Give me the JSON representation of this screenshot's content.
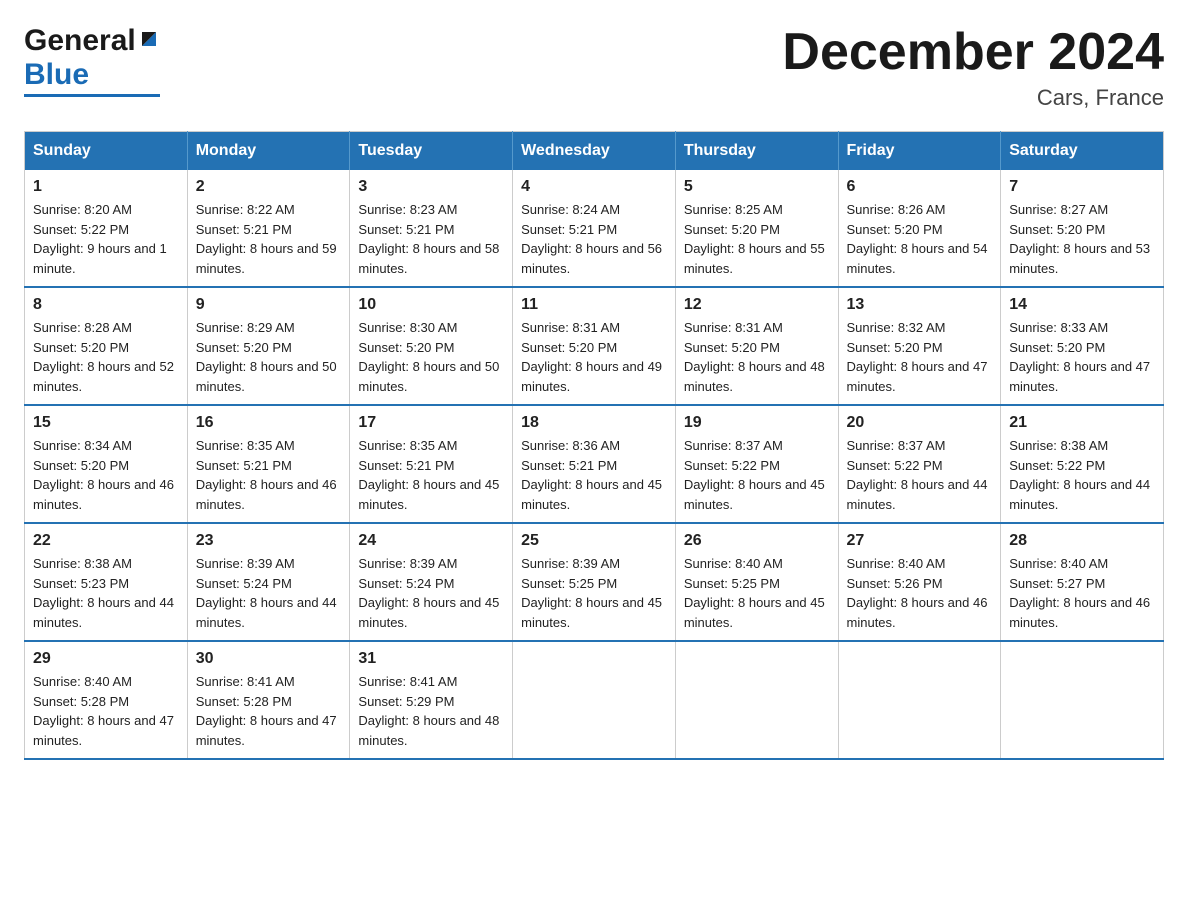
{
  "logo": {
    "general": "General",
    "blue": "Blue"
  },
  "title": "December 2024",
  "location": "Cars, France",
  "days_header": [
    "Sunday",
    "Monday",
    "Tuesday",
    "Wednesday",
    "Thursday",
    "Friday",
    "Saturday"
  ],
  "weeks": [
    [
      {
        "day": "1",
        "sunrise": "8:20 AM",
        "sunset": "5:22 PM",
        "daylight": "9 hours and 1 minute."
      },
      {
        "day": "2",
        "sunrise": "8:22 AM",
        "sunset": "5:21 PM",
        "daylight": "8 hours and 59 minutes."
      },
      {
        "day": "3",
        "sunrise": "8:23 AM",
        "sunset": "5:21 PM",
        "daylight": "8 hours and 58 minutes."
      },
      {
        "day": "4",
        "sunrise": "8:24 AM",
        "sunset": "5:21 PM",
        "daylight": "8 hours and 56 minutes."
      },
      {
        "day": "5",
        "sunrise": "8:25 AM",
        "sunset": "5:20 PM",
        "daylight": "8 hours and 55 minutes."
      },
      {
        "day": "6",
        "sunrise": "8:26 AM",
        "sunset": "5:20 PM",
        "daylight": "8 hours and 54 minutes."
      },
      {
        "day": "7",
        "sunrise": "8:27 AM",
        "sunset": "5:20 PM",
        "daylight": "8 hours and 53 minutes."
      }
    ],
    [
      {
        "day": "8",
        "sunrise": "8:28 AM",
        "sunset": "5:20 PM",
        "daylight": "8 hours and 52 minutes."
      },
      {
        "day": "9",
        "sunrise": "8:29 AM",
        "sunset": "5:20 PM",
        "daylight": "8 hours and 50 minutes."
      },
      {
        "day": "10",
        "sunrise": "8:30 AM",
        "sunset": "5:20 PM",
        "daylight": "8 hours and 50 minutes."
      },
      {
        "day": "11",
        "sunrise": "8:31 AM",
        "sunset": "5:20 PM",
        "daylight": "8 hours and 49 minutes."
      },
      {
        "day": "12",
        "sunrise": "8:31 AM",
        "sunset": "5:20 PM",
        "daylight": "8 hours and 48 minutes."
      },
      {
        "day": "13",
        "sunrise": "8:32 AM",
        "sunset": "5:20 PM",
        "daylight": "8 hours and 47 minutes."
      },
      {
        "day": "14",
        "sunrise": "8:33 AM",
        "sunset": "5:20 PM",
        "daylight": "8 hours and 47 minutes."
      }
    ],
    [
      {
        "day": "15",
        "sunrise": "8:34 AM",
        "sunset": "5:20 PM",
        "daylight": "8 hours and 46 minutes."
      },
      {
        "day": "16",
        "sunrise": "8:35 AM",
        "sunset": "5:21 PM",
        "daylight": "8 hours and 46 minutes."
      },
      {
        "day": "17",
        "sunrise": "8:35 AM",
        "sunset": "5:21 PM",
        "daylight": "8 hours and 45 minutes."
      },
      {
        "day": "18",
        "sunrise": "8:36 AM",
        "sunset": "5:21 PM",
        "daylight": "8 hours and 45 minutes."
      },
      {
        "day": "19",
        "sunrise": "8:37 AM",
        "sunset": "5:22 PM",
        "daylight": "8 hours and 45 minutes."
      },
      {
        "day": "20",
        "sunrise": "8:37 AM",
        "sunset": "5:22 PM",
        "daylight": "8 hours and 44 minutes."
      },
      {
        "day": "21",
        "sunrise": "8:38 AM",
        "sunset": "5:22 PM",
        "daylight": "8 hours and 44 minutes."
      }
    ],
    [
      {
        "day": "22",
        "sunrise": "8:38 AM",
        "sunset": "5:23 PM",
        "daylight": "8 hours and 44 minutes."
      },
      {
        "day": "23",
        "sunrise": "8:39 AM",
        "sunset": "5:24 PM",
        "daylight": "8 hours and 44 minutes."
      },
      {
        "day": "24",
        "sunrise": "8:39 AM",
        "sunset": "5:24 PM",
        "daylight": "8 hours and 45 minutes."
      },
      {
        "day": "25",
        "sunrise": "8:39 AM",
        "sunset": "5:25 PM",
        "daylight": "8 hours and 45 minutes."
      },
      {
        "day": "26",
        "sunrise": "8:40 AM",
        "sunset": "5:25 PM",
        "daylight": "8 hours and 45 minutes."
      },
      {
        "day": "27",
        "sunrise": "8:40 AM",
        "sunset": "5:26 PM",
        "daylight": "8 hours and 46 minutes."
      },
      {
        "day": "28",
        "sunrise": "8:40 AM",
        "sunset": "5:27 PM",
        "daylight": "8 hours and 46 minutes."
      }
    ],
    [
      {
        "day": "29",
        "sunrise": "8:40 AM",
        "sunset": "5:28 PM",
        "daylight": "8 hours and 47 minutes."
      },
      {
        "day": "30",
        "sunrise": "8:41 AM",
        "sunset": "5:28 PM",
        "daylight": "8 hours and 47 minutes."
      },
      {
        "day": "31",
        "sunrise": "8:41 AM",
        "sunset": "5:29 PM",
        "daylight": "8 hours and 48 minutes."
      },
      null,
      null,
      null,
      null
    ]
  ],
  "colors": {
    "header_bg": "#2472b3",
    "header_text": "#ffffff",
    "border": "#ccc",
    "row_border": "#2472b3"
  }
}
